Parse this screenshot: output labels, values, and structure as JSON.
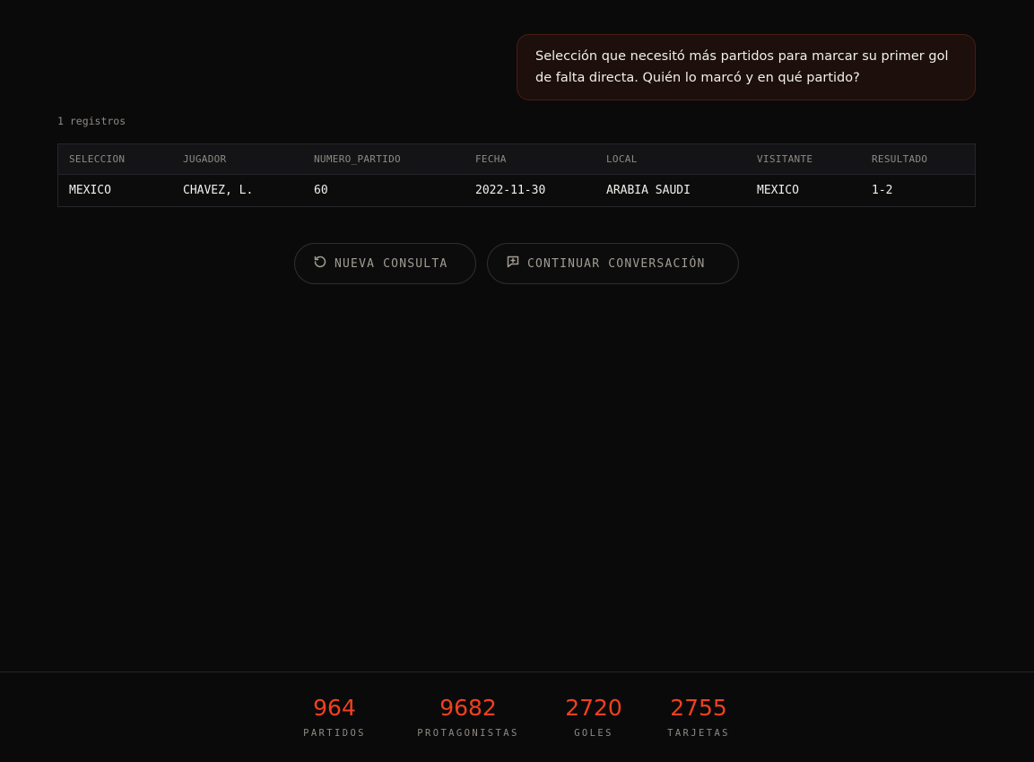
{
  "chat": {
    "user_message": "Selección que necesitó más partidos para marcar su primer gol de falta directa. Quién lo marcó y en qué partido?"
  },
  "result": {
    "records_label": "1 registros",
    "columns": [
      "SELECCION",
      "JUGADOR",
      "NUMERO_PARTIDO",
      "FECHA",
      "LOCAL",
      "VISITANTE",
      "RESULTADO"
    ],
    "rows": [
      [
        "MEXICO",
        "CHAVEZ, L.",
        "60",
        "2022-11-30",
        "ARABIA SAUDI",
        "MEXICO",
        "1-2"
      ]
    ]
  },
  "actions": {
    "new_query": {
      "label": "NUEVA CONSULTA",
      "icon": "refresh-icon"
    },
    "continue": {
      "label": "CONTINUAR CONVERSACIÓN",
      "icon": "message-plus-icon"
    }
  },
  "stats": [
    {
      "value": "964",
      "label": "PARTIDOS"
    },
    {
      "value": "9682",
      "label": "PROTAGONISTAS"
    },
    {
      "value": "2720",
      "label": "GOLES"
    },
    {
      "value": "2755",
      "label": "TARJETAS"
    }
  ],
  "colors": {
    "accent": "#f0401f",
    "background": "#0a0a0b",
    "bubble_bg": "#1c0f0c",
    "bubble_border": "#4a1d12"
  }
}
